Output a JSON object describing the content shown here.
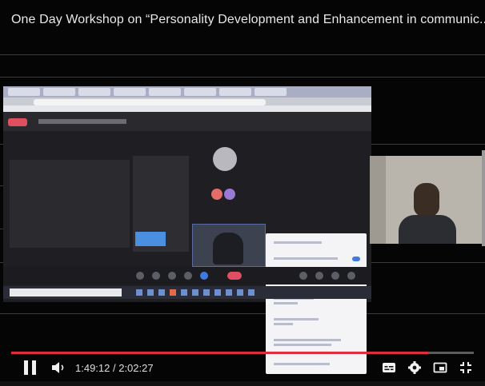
{
  "player": {
    "title": "One Day Workshop on “Personality Development and Enhancement in communic...",
    "time": "1:49:12 / 2:02:27",
    "progress_fraction": 0.902,
    "progress_color": "#e02c3c",
    "icons": {
      "pause": "pause-icon",
      "volume": "volume-icon",
      "subtitles": "subtitles-icon",
      "settings": "gear-icon",
      "miniplayer": "miniplayer-icon",
      "fullscreen_exit": "fullscreen-exit-icon"
    }
  }
}
